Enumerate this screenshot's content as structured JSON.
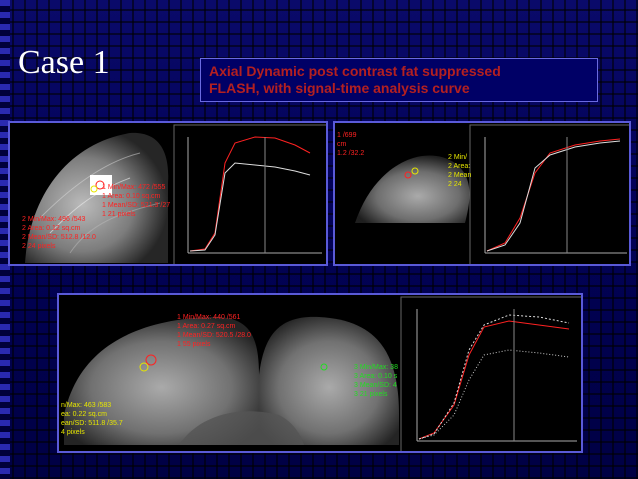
{
  "slide": {
    "title": "Case 1",
    "header": {
      "line1": "Axial Dynamic post contrast fat suppressed",
      "line2": "FLASH, with signal-time analysis curve"
    }
  },
  "panel1": {
    "roi1": [
      "1 Min/Max: 472 /555",
      "1 Area: 0.10 sq.cm",
      "1 Mean/SD: 521.3 /27",
      "1   21 pixels"
    ],
    "roi2": [
      "2 Min/Max: 496 /543",
      "2 Area: 0.12 sq.cm",
      "2 Mean/SD: 512.8 /12.0",
      "2   24 pixels"
    ],
    "markers": [
      "1",
      "2"
    ]
  },
  "panel2": {
    "roi1": [
      "1 /699",
      "cm",
      "1.2 /32.2"
    ],
    "roi2": [
      "2 Min/",
      "2 Area:",
      "2 Mean",
      "2   24"
    ]
  },
  "panel3": {
    "roi1": [
      "1 Min/Max: 440 /561",
      "1 Area: 0.27 sq.cm",
      "1 Mean/SD: 520.5 /28.0",
      "1   55 pixels"
    ],
    "roi2": [
      "n/Max: 463 /583",
      "ea: 0.22 sq.cm",
      "ean/SD: 511.8 /35.7",
      "4 pixels"
    ],
    "roi3": [
      "3 Min/Max: 38",
      "3 Area: 0.10 s",
      "3 Mean/SD: 4",
      "3   21 pixels"
    ],
    "markers": [
      "1",
      "2"
    ]
  },
  "colors": {
    "background": "#00004a",
    "header_text": "#b42020",
    "panel_border": "#5a5ad8",
    "roi_red": "#ff2222",
    "roi_yellow": "#e6e600"
  }
}
